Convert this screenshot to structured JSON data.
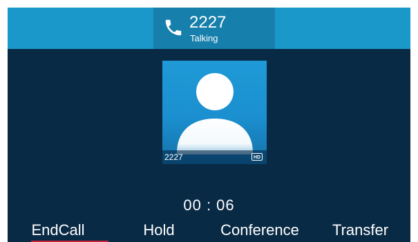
{
  "header": {
    "number": "2227",
    "status": "Talking"
  },
  "contact_card": {
    "name": "2227",
    "badge": "HD"
  },
  "timer": "00 : 06",
  "softkeys": [
    {
      "label": "EndCall"
    },
    {
      "label": "Hold"
    },
    {
      "label": "Conference"
    },
    {
      "label": "Transfer"
    }
  ],
  "colors": {
    "topbar": "#1b98ca",
    "call_tab": "#167fab",
    "background": "#092a45",
    "card": "#1f9ad7",
    "endcall_accent": "#c8243a"
  },
  "icons": {
    "call": "phone-handset-icon",
    "contact": "person-avatar-icon"
  }
}
